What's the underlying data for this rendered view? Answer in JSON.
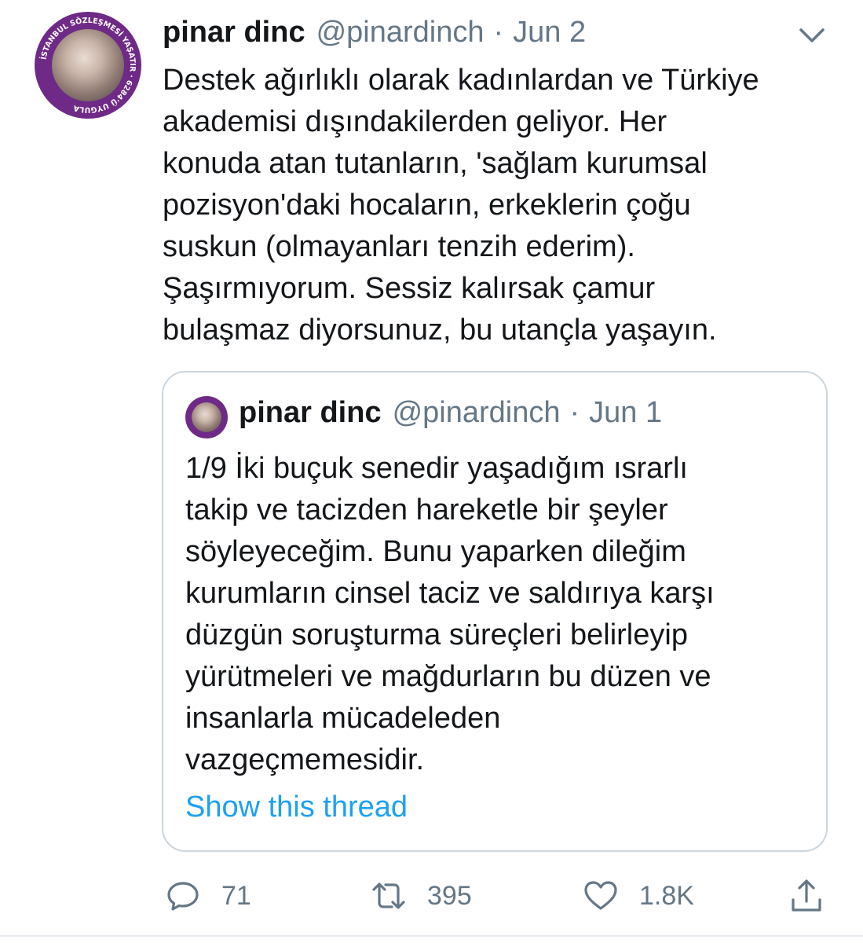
{
  "tweet": {
    "author_name": "pinar dinc",
    "author_handle": "@pinardinch",
    "separator": "·",
    "date": "Jun 2",
    "avatar_ring_text": "İSTANBUL SÖZLEŞMESİ YAŞATIR · 6284'Ü UYGULA",
    "menu_icon": "chevron-down-icon",
    "text_lines": [
      "Destek ağırlıklı olarak kadınlardan ve Türkiye",
      "akademisi dışındakilerden geliyor. Her",
      "konuda atan tutanların, 'sağlam kurumsal",
      "pozisyon'daki hocaların, erkeklerin çoğu",
      "suskun (olmayanları tenzih ederim).",
      "Şaşırmıyorum. Sessiz kalırsak çamur",
      "bulaşmaz diyorsunuz, bu utançla yaşayın."
    ]
  },
  "quoted": {
    "author_name": "pinar dinc",
    "author_handle": "@pinardinch",
    "separator": "·",
    "date": "Jun 1",
    "text_lines": [
      "1/9 İki buçuk senedir yaşadığım ısrarlı",
      "takip ve tacizden hareketle bir şeyler",
      "söyleyeceğim. Bunu yaparken dileğim",
      "kurumların cinsel taciz ve saldırıya karşı",
      "düzgün soruşturma süreçleri belirleyip",
      "yürütmeleri ve mağdurların bu düzen ve",
      "insanlarla mücadeleden",
      "vazgeçmemesidir."
    ],
    "show_thread_label": "Show this thread"
  },
  "actions": {
    "reply": {
      "icon": "reply-icon",
      "count": "71"
    },
    "retweet": {
      "icon": "retweet-icon",
      "count": "395"
    },
    "like": {
      "icon": "heart-icon",
      "count": "1.8K"
    },
    "share": {
      "icon": "share-icon"
    }
  },
  "colors": {
    "text": "#14171a",
    "secondary": "#657786",
    "link": "#1da1f2",
    "border": "#ccd6dd",
    "avatar_ring": "#6e2a86"
  }
}
